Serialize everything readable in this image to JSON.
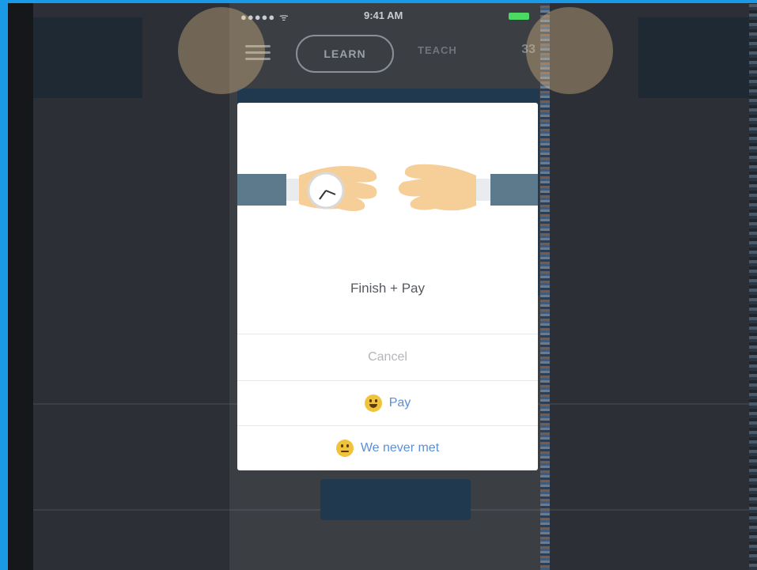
{
  "status_bar": {
    "signal": "●●●●● ᯤ",
    "time": "9:41 AM",
    "battery_color": "#4cd964"
  },
  "nav": {
    "tab_learn": "LEARN",
    "tab_teach": "TEACH",
    "extra": "33"
  },
  "dialog": {
    "title": "Finish + Pay",
    "cancel_label": "Cancel",
    "pay_label": "Pay",
    "pay_icon": "happy-face-icon",
    "never_met_label": "We never met",
    "never_met_icon": "neutral-face-icon"
  },
  "colors": {
    "outer_border": "#1a9ae6",
    "action_text": "#5b8fd6",
    "cancel_text": "#b3b6ba",
    "dark_panel": "#20394f"
  }
}
